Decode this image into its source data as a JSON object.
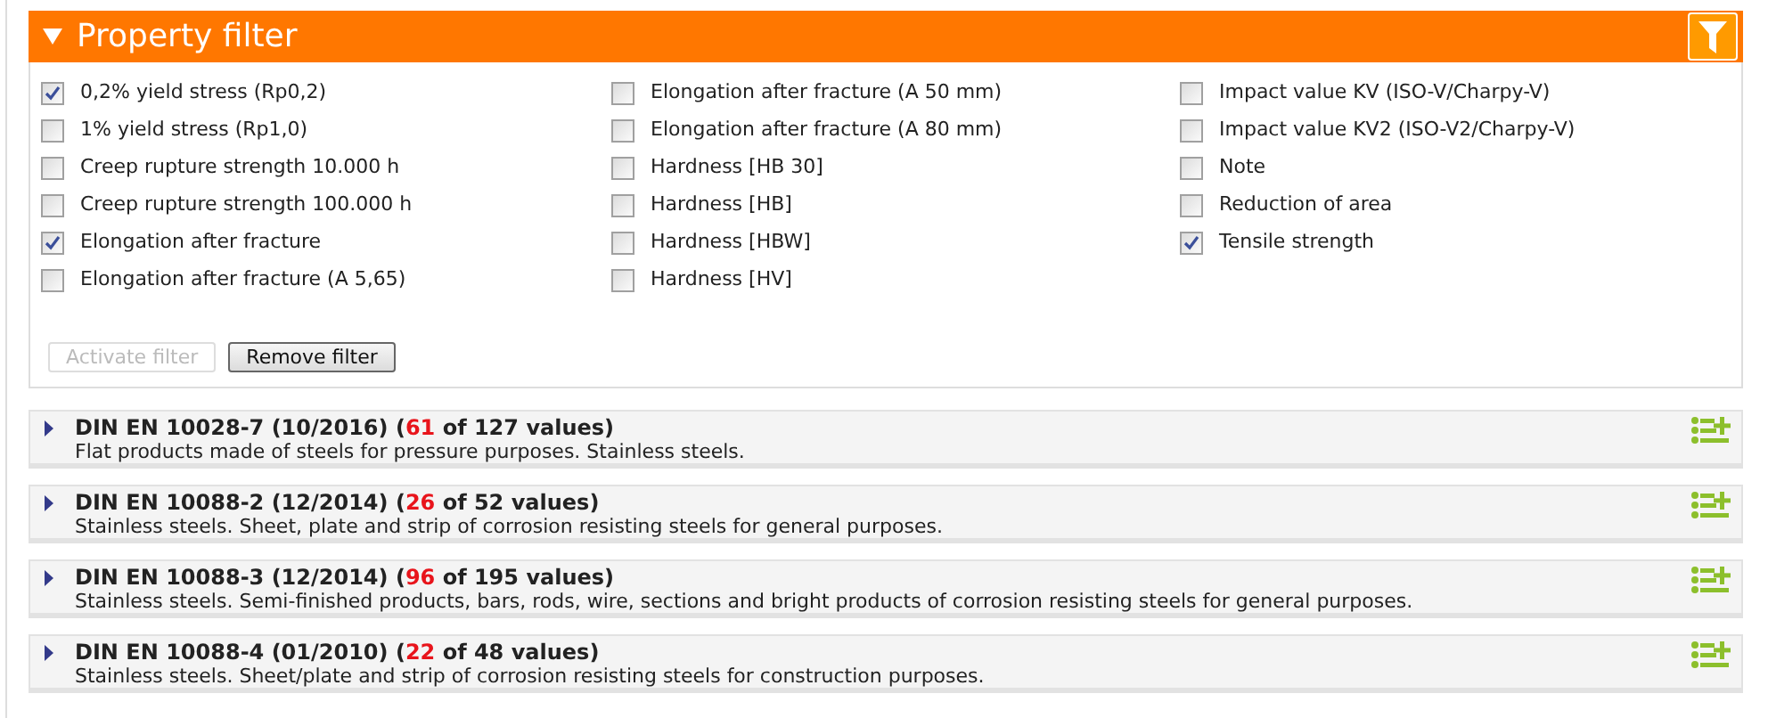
{
  "filter": {
    "title": "Property filter",
    "expanded": true,
    "columns": [
      [
        {
          "label": "0,2% yield stress (Rp0,2)",
          "checked": true
        },
        {
          "label": "1% yield stress (Rp1,0)",
          "checked": false
        },
        {
          "label": "Creep rupture strength 10.000 h",
          "checked": false
        },
        {
          "label": "Creep rupture strength 100.000 h",
          "checked": false
        },
        {
          "label": "Elongation after fracture",
          "checked": true
        },
        {
          "label": "Elongation after fracture (A 5,65)",
          "checked": false
        }
      ],
      [
        {
          "label": "Elongation after fracture (A 50 mm)",
          "checked": false
        },
        {
          "label": "Elongation after fracture (A 80 mm)",
          "checked": false
        },
        {
          "label": "Hardness [HB 30]",
          "checked": false
        },
        {
          "label": "Hardness [HB]",
          "checked": false
        },
        {
          "label": "Hardness [HBW]",
          "checked": false
        },
        {
          "label": "Hardness [HV]",
          "checked": false
        }
      ],
      [
        {
          "label": "Impact value KV (ISO-V/Charpy-V)",
          "checked": false
        },
        {
          "label": "Impact value KV2 (ISO-V2/Charpy-V)",
          "checked": false
        },
        {
          "label": "Note",
          "checked": false
        },
        {
          "label": "Reduction of area",
          "checked": false
        },
        {
          "label": "Tensile strength",
          "checked": true
        }
      ]
    ],
    "buttons": [
      {
        "label": "Activate filter",
        "disabled": true
      },
      {
        "label": "Remove filter",
        "disabled": false
      }
    ]
  },
  "standards": [
    {
      "prefix": "DIN EN 10028-7 (10/2016) (",
      "count": "61",
      "suffix": " of 127 values)",
      "description": "Flat products made of steels for pressure purposes. Stainless steels."
    },
    {
      "prefix": "DIN EN 10088-2 (12/2014) (",
      "count": "26",
      "suffix": " of 52 values)",
      "description": "Stainless steels. Sheet, plate and strip of corrosion resisting steels for general purposes."
    },
    {
      "prefix": "DIN EN 10088-3 (12/2014) (",
      "count": "96",
      "suffix": " of 195 values)",
      "description": "Stainless steels. Semi-finished products, bars, rods, wire, sections and bright products of corrosion resisting steels for general purposes."
    },
    {
      "prefix": "DIN EN 10088-4 (01/2010) (",
      "count": "22",
      "suffix": " of 48 values)",
      "description": "Stainless steels. Sheet/plate and strip of corrosion resisting steels for construction purposes."
    }
  ]
}
